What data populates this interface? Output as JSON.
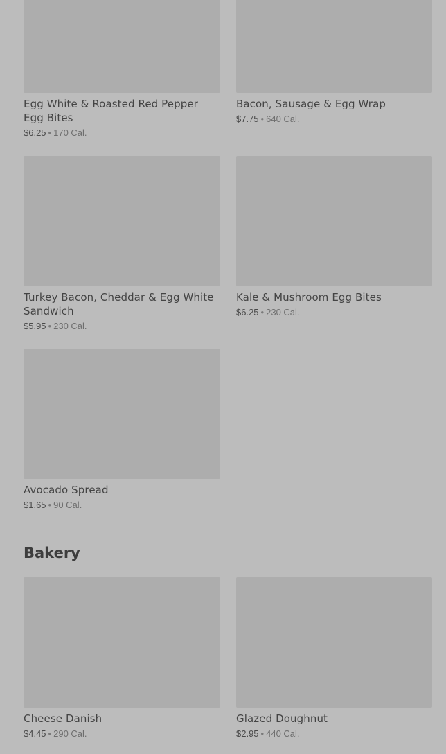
{
  "breakfast_items": [
    {
      "name": "Egg White & Roasted Red Pepper Egg Bites",
      "price": "$6.25",
      "separator": "•",
      "calories": "170 Cal."
    },
    {
      "name": "Bacon, Sausage & Egg Wrap",
      "price": "$7.75",
      "separator": "•",
      "calories": "640 Cal."
    },
    {
      "name": "Turkey Bacon, Cheddar & Egg White Sandwich",
      "price": "$5.95",
      "separator": "•",
      "calories": "230 Cal."
    },
    {
      "name": "Kale & Mushroom Egg Bites",
      "price": "$6.25",
      "separator": "•",
      "calories": "230 Cal."
    },
    {
      "name": "Avocado Spread",
      "price": "$1.65",
      "separator": "•",
      "calories": "90 Cal."
    }
  ],
  "bakery": {
    "title": "Bakery",
    "items": [
      {
        "name": "Cheese Danish",
        "price": "$4.45",
        "separator": "•",
        "calories": "290 Cal."
      },
      {
        "name": "Glazed Doughnut",
        "price": "$2.95",
        "separator": "•",
        "calories": "440 Cal."
      }
    ]
  },
  "colors": {
    "background": "#bcbcbc",
    "image_placeholder": "#adadad",
    "text_primary": "#444444"
  }
}
